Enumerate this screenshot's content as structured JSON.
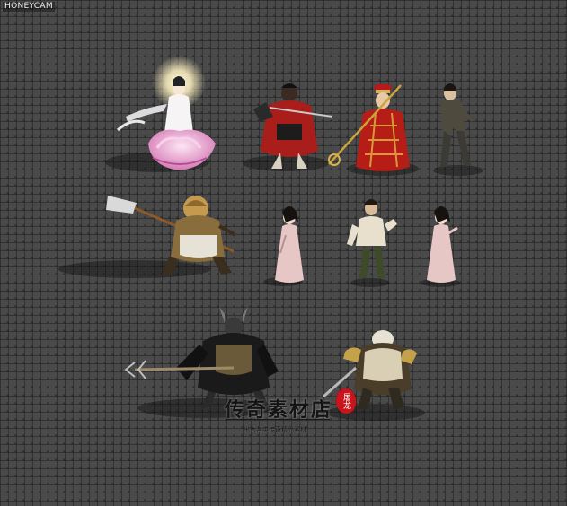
{
  "overlay": {
    "recorder_label": "HONEYCAM"
  },
  "watermark": {
    "title": "传奇素材店",
    "subtitle": "出售各类传奇精品素材",
    "seal_text": "屠龙"
  },
  "sprites": [
    {
      "name": "guanyin-on-lotus",
      "row": 1
    },
    {
      "name": "red-robed-warrior-with-sword",
      "row": 1
    },
    {
      "name": "monk-with-staff",
      "row": 1
    },
    {
      "name": "young-man-villager",
      "row": 1
    },
    {
      "name": "monkey-king-with-halberd",
      "row": 2
    },
    {
      "name": "lady-in-pink-robe-1",
      "row": 2
    },
    {
      "name": "white-shirt-villager",
      "row": 2
    },
    {
      "name": "lady-in-pink-robe-2",
      "row": 2
    },
    {
      "name": "horned-demon-with-trident",
      "row": 3
    },
    {
      "name": "white-armored-boar-warrior",
      "row": 3
    }
  ],
  "colors": {
    "background": "#4a4a4a",
    "seal": "#c8141a",
    "lotus": "#e9a7cf",
    "halo": "#fff2c0"
  }
}
